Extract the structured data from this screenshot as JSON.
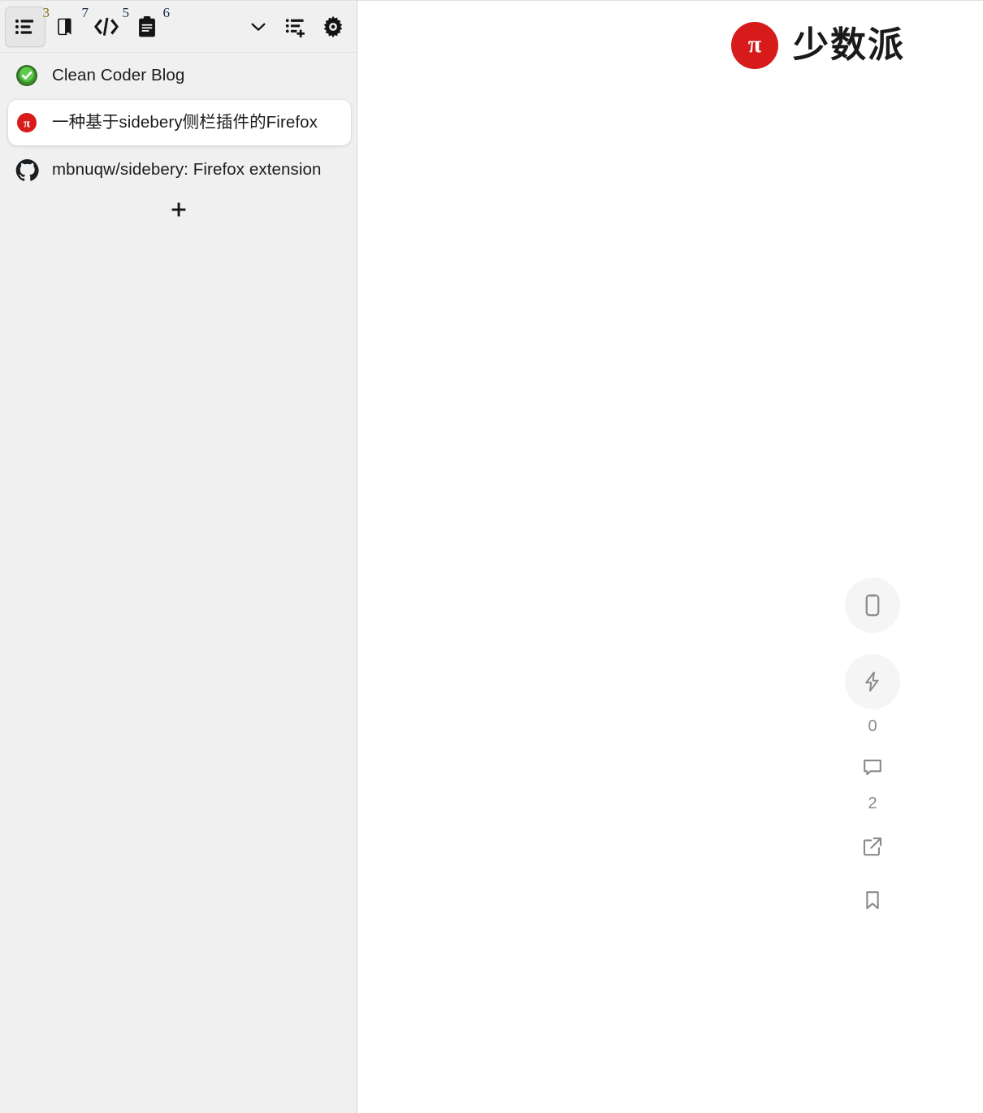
{
  "sidebar": {
    "toolbar": {
      "buttons": [
        {
          "name": "panel-tabs",
          "icon": "list-icon",
          "badge": "3",
          "active": true
        },
        {
          "name": "panel-bookmarks",
          "icon": "book-icon",
          "badge": "7",
          "active": false
        },
        {
          "name": "panel-dev",
          "icon": "code-icon",
          "badge": "5",
          "active": false
        },
        {
          "name": "panel-notes",
          "icon": "clipboard-icon",
          "badge": "6",
          "active": false
        }
      ],
      "actions": [
        {
          "name": "panel-menu",
          "icon": "chevron-down-icon"
        },
        {
          "name": "new-panel",
          "icon": "list-plus-icon"
        },
        {
          "name": "settings",
          "icon": "gear-icon"
        }
      ]
    },
    "tabs": [
      {
        "title": "Clean Coder Blog",
        "favicon": "green-check-icon",
        "active": false
      },
      {
        "title": "一种基于sidebery侧栏插件的Firefox",
        "favicon": "sspai-pi-icon",
        "active": true
      },
      {
        "title": "mbnuqw/sidebery: Firefox extension",
        "favicon": "github-icon",
        "active": false
      }
    ],
    "new_tab": {
      "label": "+",
      "icon": "plus-icon"
    }
  },
  "page": {
    "brand": {
      "logo": "sspai-logo",
      "mark_glyph": "π",
      "name": "少数派"
    },
    "rail": [
      {
        "name": "mobile-view",
        "icon": "phone-icon",
        "count": null,
        "circle": true
      },
      {
        "name": "like",
        "icon": "lightning-icon",
        "count": "0",
        "circle": true
      },
      {
        "name": "comments",
        "icon": "comment-icon",
        "count": "2",
        "circle": false
      },
      {
        "name": "share",
        "icon": "external-link-icon",
        "count": null,
        "circle": false
      },
      {
        "name": "bookmark",
        "icon": "bookmark-icon",
        "count": null,
        "circle": false
      }
    ]
  },
  "colors": {
    "brand_red": "#d71a1a",
    "sidebar_bg": "#f0f0f0",
    "active_tab_bg": "#ffffff",
    "badge_active": "#8a6a12",
    "badge": "#1b2a4a",
    "rail_icon": "#8a8a8a"
  }
}
